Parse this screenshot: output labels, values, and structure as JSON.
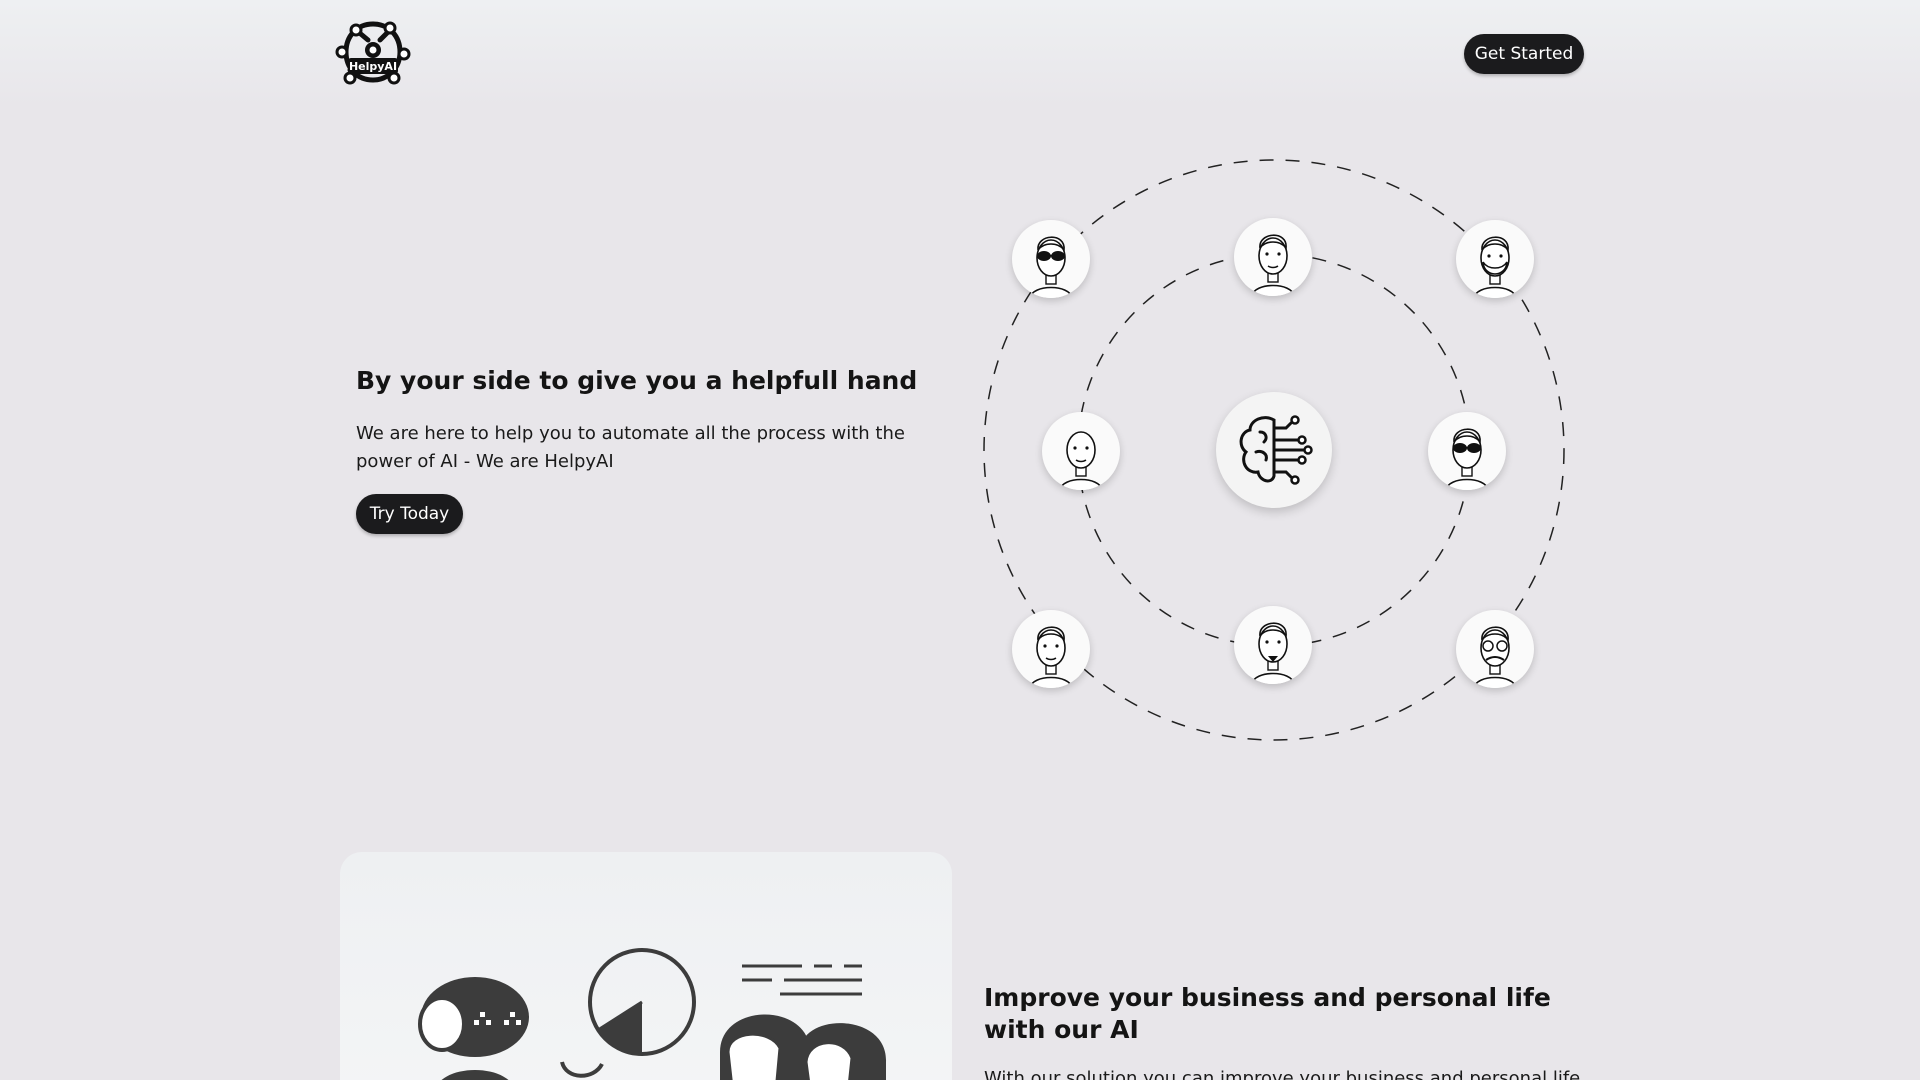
{
  "header": {
    "logo_text": "HelpyAI",
    "cta_label": "Get Started"
  },
  "hero": {
    "title": "By your side to give you a helpfull hand",
    "description": "We are here to help you to automate all the process with the power of AI - We are HelpyAI",
    "button_label": "Try Today"
  },
  "orbit": {
    "center_icon": "brain-circuit-icon",
    "avatars": [
      "avatar-sunglasses-man",
      "avatar-young-man",
      "avatar-bearded-old-man",
      "avatar-bald-man",
      "avatar-sunglasses-long-hair",
      "avatar-curly-man",
      "avatar-goatee-man",
      "avatar-glasses-old-man"
    ]
  },
  "feature": {
    "title": "Improve your business and personal life with our AI",
    "description": "With our solution you can improve your business and personal life"
  }
}
